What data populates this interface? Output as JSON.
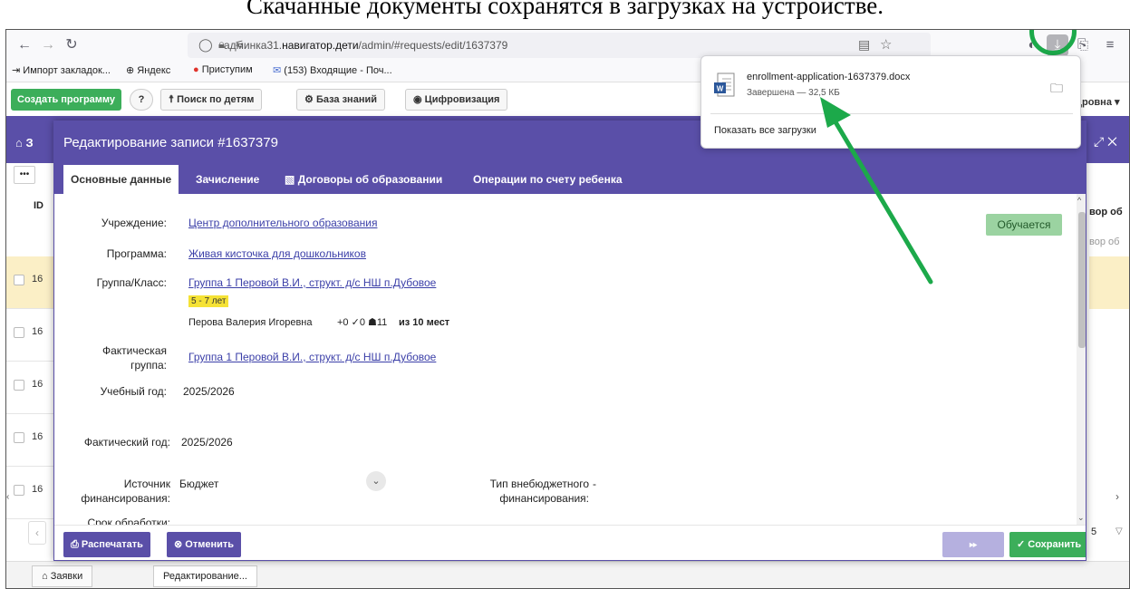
{
  "caption": "Скачанные документы сохранятся в загрузках на устройстве.",
  "browser": {
    "address_host": "админка31.",
    "address_domain": "навигатор.дети",
    "address_path": "/admin/#requests/edit/1637379",
    "bookmarks": [
      "Импорт закладок...",
      "Яндекс",
      "Приступим",
      "(153) Входящие - Поч..."
    ]
  },
  "downloads": {
    "file_name": "enrollment-application-1637379.docx",
    "status": "Завершена — 32,5 КБ",
    "show_all": "Показать все загрузки"
  },
  "appbar": {
    "create_program": "Создать программу",
    "help": "?",
    "search_children": "Поиск по детям",
    "knowledge_base": "База знаний",
    "digitalization": "Цифровизация",
    "user_partial": "дровна ▾"
  },
  "background": {
    "header_title": "З",
    "row_ids": [
      "16",
      "16",
      "16",
      "16",
      "16"
    ],
    "right_col_1": "вор об",
    "right_col_2": "вор об",
    "page_num": "5",
    "tabs": [
      "Заявки",
      "Редактирование..."
    ]
  },
  "modal": {
    "title": "Редактирование записи #1637379",
    "tabs": [
      "Основные данные",
      "Зачисление",
      "Договоры об образовании",
      "Операции по счету ребенка"
    ],
    "status": "Обучается",
    "fields": {
      "institution_label": "Учреждение:",
      "institution_value": "Центр дополнительного образования",
      "program_label": "Программа:",
      "program_value": "Живая кисточка для дошкольников",
      "group_label": "Группа/Класс:",
      "group_value": "Группа 1 Перовой В.И., структ. д/с НШ п.Дубовое",
      "age_badge": "5 - 7 лет",
      "teacher": "Перова Валерия Игоревна",
      "stats": "+0  ✓0  ☗11",
      "seats": "из 10 мест",
      "actual_group_label": "Фактическая группа:",
      "actual_group_value": "Группа 1 Перовой В.И., структ. д/с НШ п.Дубовое",
      "study_year_label": "Учебный год:",
      "study_year_value": "2025/2026",
      "actual_year_label": "Фактический год:",
      "actual_year_value": "2025/2026",
      "funding_label": "Источник финансирования:",
      "funding_value": "Бюджет",
      "extra_funding_label": "Тип внебюджетного финансирования:",
      "extra_funding_value": "-",
      "processing_label": "Срок обработки:"
    },
    "footer": {
      "print": "Распечатать",
      "cancel": "Отменить",
      "save": "Сохранить"
    }
  },
  "colors": {
    "accent_purple": "#5a4fa8",
    "green": "#3cae5a",
    "annotation_green": "#1ca94a"
  }
}
